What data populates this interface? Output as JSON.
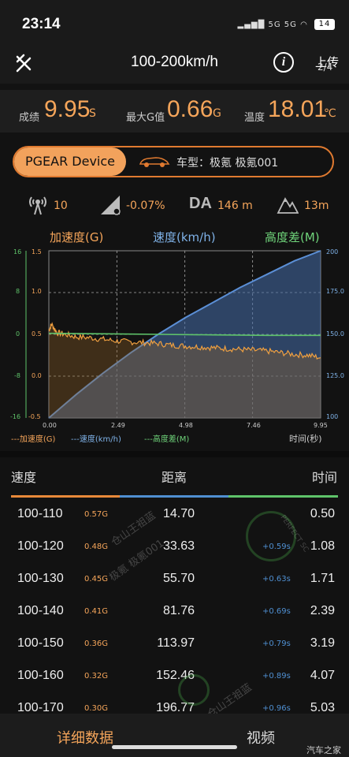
{
  "status_bar": {
    "time": "23:14",
    "signal_text": "5G 5G",
    "battery": "14"
  },
  "header": {
    "title": "100-200km/h",
    "upload": "上传",
    "page": "2/4"
  },
  "summary": {
    "score_label": "成绩",
    "score_value": "9.95",
    "score_unit": "S",
    "gmax_label": "最大G值",
    "gmax_value": "0.66",
    "gmax_unit": "G",
    "temp_label": "温度",
    "temp_value": "18.01",
    "temp_unit": "℃"
  },
  "device": {
    "name": "PGEAR Device",
    "car": "车型：极氪 极氪001"
  },
  "metrics": {
    "satellites": "10",
    "slope": "-0.07%",
    "da_label": "DA",
    "da_value": "146 m",
    "altitude": "13m"
  },
  "chart_data": {
    "type": "line",
    "legend_top": [
      "加速度(G)",
      "速度(km/h)",
      "高度差(M)"
    ],
    "legend_bottom": [
      "---加速度(G)",
      "---速度(km/h)",
      "---高度差(M)"
    ],
    "xlabel": "时间(秒)",
    "x_ticks": [
      "0.00",
      "2.49",
      "4.98",
      "7.46",
      "9.95"
    ],
    "y_accel_ticks": [
      "1.5",
      "1.0",
      "0.5",
      "0.0",
      "-0.5"
    ],
    "y_alt_ticks": [
      "16",
      "8",
      "0",
      "-8",
      "-16"
    ],
    "y_speed_ticks": [
      "200",
      "175.0",
      "150.0",
      "125.0",
      "100"
    ],
    "xlim": [
      0,
      9.95
    ],
    "accel_ylim": [
      -0.5,
      1.5
    ],
    "speed_ylim": [
      100,
      200
    ],
    "alt_ylim": [
      -16,
      16
    ],
    "series": [
      {
        "name": "速度(km/h)",
        "color": "#5b8fd6",
        "x": [
          0,
          1,
          2,
          3,
          4,
          5,
          6,
          7,
          8,
          9,
          9.95
        ],
        "values": [
          100,
          114,
          127,
          139,
          150,
          160,
          169,
          178,
          186,
          194,
          200
        ]
      },
      {
        "name": "加速度(G)",
        "color": "#f0a040",
        "x": [
          0,
          0.1,
          0.3,
          0.6,
          1,
          1.5,
          2,
          2.5,
          3,
          3.5,
          4,
          4.5,
          5,
          5.5,
          6,
          6.5,
          7,
          7.5,
          8,
          8.5,
          9,
          9.5,
          9.95
        ],
        "values": [
          0.55,
          0.62,
          0.52,
          0.5,
          0.47,
          0.46,
          0.44,
          0.42,
          0.41,
          0.4,
          0.39,
          0.37,
          0.36,
          0.35,
          0.34,
          0.33,
          0.32,
          0.31,
          0.3,
          0.28,
          0.26,
          0.25,
          0.22
        ]
      },
      {
        "name": "高度差(M)",
        "color": "#5fc46a",
        "x": [
          0,
          2,
          4,
          6,
          8,
          9.95
        ],
        "values": [
          0.2,
          0.1,
          0,
          -0.1,
          -0.2,
          -0.2
        ]
      }
    ],
    "grid": true
  },
  "table": {
    "headers": [
      "速度",
      "距离",
      "时间"
    ],
    "rows": [
      {
        "range": "100-110",
        "g": "0.57G",
        "dist": "14.70",
        "delta": "",
        "time": "0.50"
      },
      {
        "range": "100-120",
        "g": "0.48G",
        "dist": "33.63",
        "delta": "+0.59s",
        "time": "1.08"
      },
      {
        "range": "100-130",
        "g": "0.45G",
        "dist": "55.70",
        "delta": "+0.63s",
        "time": "1.71"
      },
      {
        "range": "100-140",
        "g": "0.41G",
        "dist": "81.76",
        "delta": "+0.69s",
        "time": "2.39"
      },
      {
        "range": "100-150",
        "g": "0.36G",
        "dist": "113.97",
        "delta": "+0.79s",
        "time": "3.19"
      },
      {
        "range": "100-160",
        "g": "0.32G",
        "dist": "152.46",
        "delta": "+0.89s",
        "time": "4.07"
      },
      {
        "range": "100-170",
        "g": "0.30G",
        "dist": "196.77",
        "delta": "+0.96s",
        "time": "5.03"
      }
    ]
  },
  "watermarks": {
    "text1": "仓山王祖蓝",
    "text2": "极氪 极氪001",
    "text3": "仓山王祖蓝",
    "seal_text": "PERFECT SC"
  },
  "bottom_nav": {
    "detail": "详细数据",
    "video": "视频",
    "corner": "汽车之家"
  }
}
